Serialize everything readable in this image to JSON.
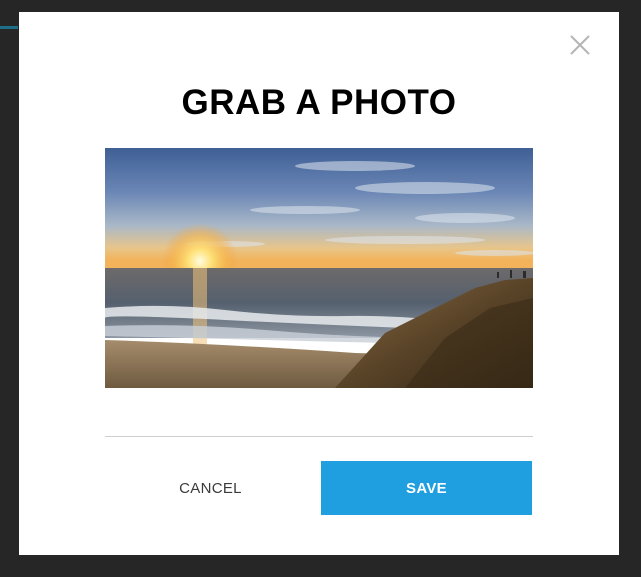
{
  "modal": {
    "title": "GRAB A PHOTO",
    "close_icon": "close-icon",
    "photo": {
      "subject": "sunset over ocean beach with rocky cliff"
    },
    "buttons": {
      "cancel_label": "CANCEL",
      "save_label": "SAVE"
    }
  },
  "colors": {
    "backdrop": "#262626",
    "modal_background": "#ffffff",
    "title": "#000000",
    "save_button": "#1f9fe0",
    "save_text": "#ffffff",
    "cancel_text": "#3a3a3a",
    "divider": "#cfcfcf",
    "close_icon": "#b5b5b5"
  }
}
